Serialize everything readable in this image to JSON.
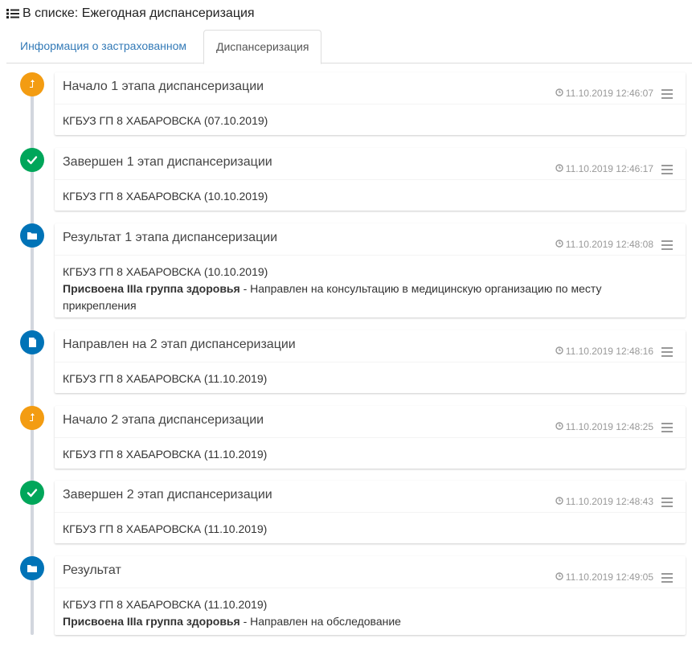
{
  "heading": {
    "icon": "list-icon",
    "text": "В списке: Ежегодная диспансеризация"
  },
  "tabs": [
    {
      "label": "Информация о застрахованном",
      "active": false
    },
    {
      "label": "Диспансеризация",
      "active": true
    }
  ],
  "colors": {
    "orange": "#f39c12",
    "green": "#00a65a",
    "blue": "#0073b7",
    "link": "#337ab7"
  },
  "events": [
    {
      "icon": "level-up-icon",
      "color": "orange",
      "title": "Начало 1 этапа диспансеризации",
      "time": "11.10.2019 12:46:07",
      "org": "КГБУЗ ГП 8 ХАБАРОВСКА (07.10.2019)",
      "result_bold": "",
      "result_text": ""
    },
    {
      "icon": "check-icon",
      "color": "green",
      "title": "Завершен 1 этап диспансеризации",
      "time": "11.10.2019 12:46:17",
      "org": "КГБУЗ ГП 8 ХАБАРОВСКА (10.10.2019)",
      "result_bold": "",
      "result_text": ""
    },
    {
      "icon": "folder-icon",
      "color": "blue",
      "title": "Результат 1 этапа диспансеризации",
      "time": "11.10.2019 12:48:08",
      "org": "КГБУЗ ГП 8 ХАБАРОВСКА (10.10.2019)",
      "result_bold": "Присвоена IIIа группа здоровья",
      "result_text": " - Направлен на консультацию в медицинскую организацию по месту прикрепления"
    },
    {
      "icon": "file-icon",
      "color": "blue",
      "title": "Направлен на 2 этап диспансеризации",
      "time": "11.10.2019 12:48:16",
      "org": "КГБУЗ ГП 8 ХАБАРОВСКА (11.10.2019)",
      "result_bold": "",
      "result_text": ""
    },
    {
      "icon": "level-up-icon",
      "color": "orange",
      "title": "Начало 2 этапа диспансеризации",
      "time": "11.10.2019 12:48:25",
      "org": "КГБУЗ ГП 8 ХАБАРОВСКА (11.10.2019)",
      "result_bold": "",
      "result_text": ""
    },
    {
      "icon": "check-icon",
      "color": "green",
      "title": "Завершен 2 этап диспансеризации",
      "time": "11.10.2019 12:48:43",
      "org": "КГБУЗ ГП 8 ХАБАРОВСКА (11.10.2019)",
      "result_bold": "",
      "result_text": ""
    },
    {
      "icon": "folder-icon",
      "color": "blue",
      "title": "Результат",
      "time": "11.10.2019 12:49:05",
      "org": "КГБУЗ ГП 8 ХАБАРОВСКА (11.10.2019)",
      "result_bold": "Присвоена IIIа группа здоровья",
      "result_text": " - Направлен на обследование"
    }
  ]
}
